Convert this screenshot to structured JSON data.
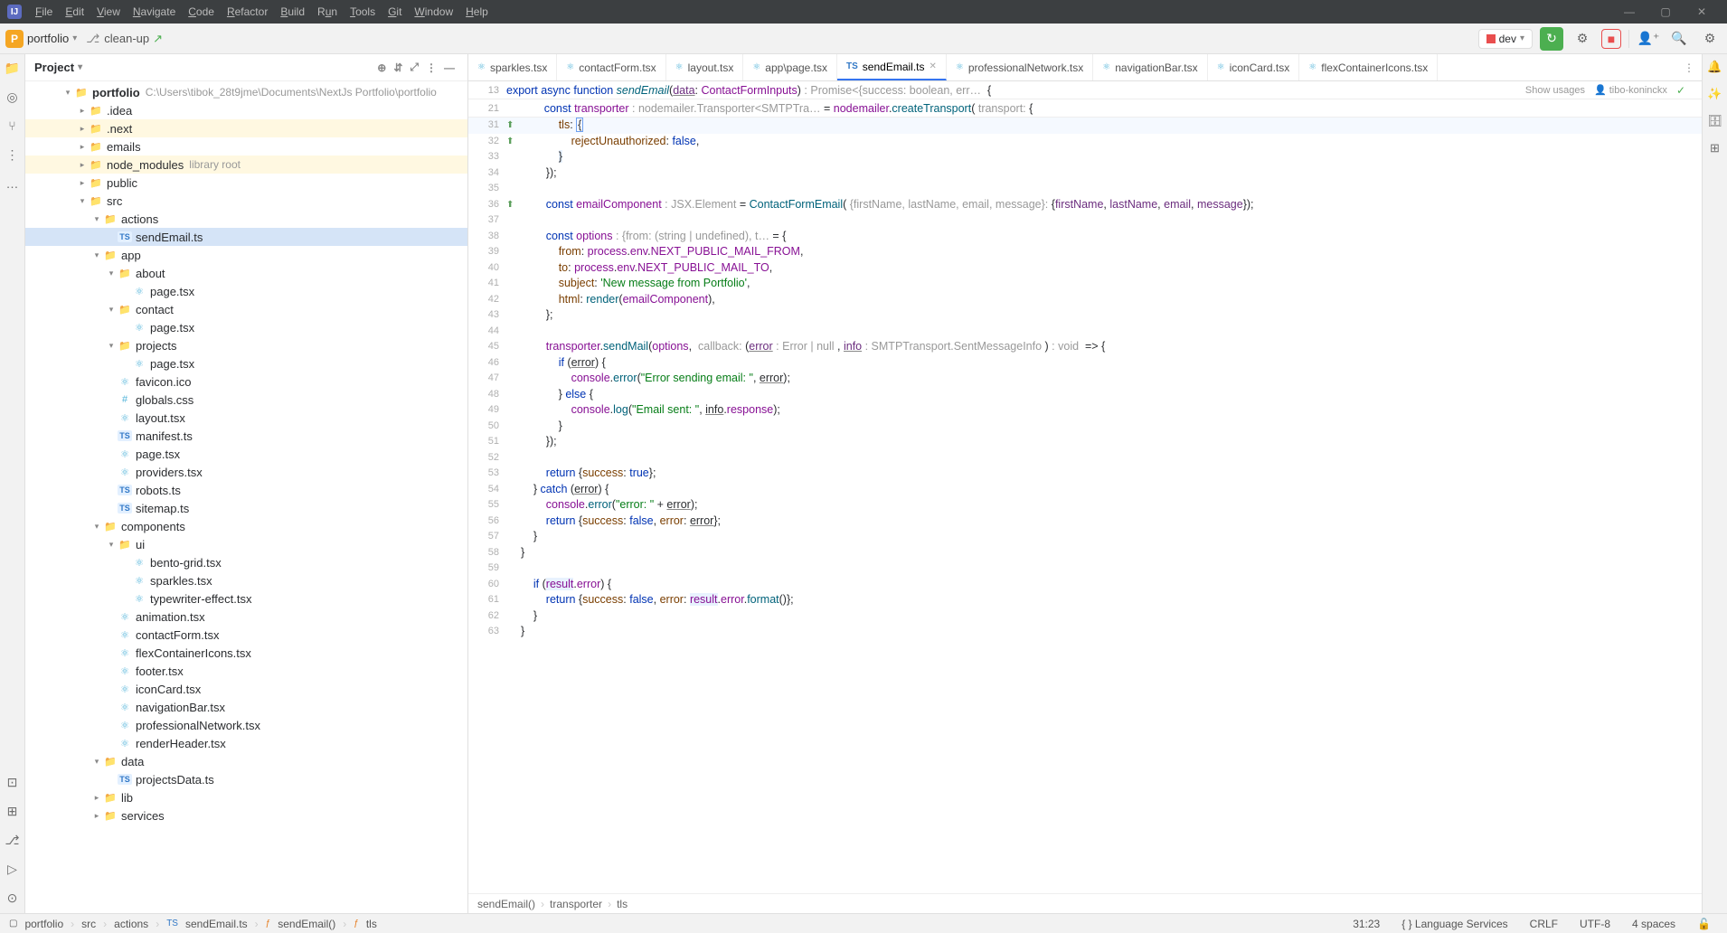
{
  "menubar": {
    "items": [
      "File",
      "Edit",
      "View",
      "Navigate",
      "Code",
      "Refactor",
      "Build",
      "Run",
      "Tools",
      "Git",
      "Window",
      "Help"
    ]
  },
  "toolbar": {
    "project": "portfolio",
    "branch": "clean-up",
    "dev": "dev"
  },
  "sidebar": {
    "title": "Project",
    "root": {
      "name": "portfolio",
      "path": "C:\\Users\\tibok_28t9jme\\Documents\\NextJs Portfolio\\portfolio"
    }
  },
  "tree": [
    {
      "d": 0,
      "a": "v",
      "i": "folder",
      "t": "portfolio",
      "bold": true,
      "extra": "C:\\Users\\tibok_28t9jme\\Documents\\NextJs Portfolio\\portfolio"
    },
    {
      "d": 1,
      "a": ">",
      "i": "folder",
      "t": ".idea",
      "hl": false
    },
    {
      "d": 1,
      "a": ">",
      "i": "folder",
      "t": ".next",
      "hl": true
    },
    {
      "d": 1,
      "a": ">",
      "i": "folder",
      "t": "emails"
    },
    {
      "d": 1,
      "a": ">",
      "i": "folder",
      "t": "node_modules",
      "hl": true,
      "extra": "library root"
    },
    {
      "d": 1,
      "a": ">",
      "i": "folder",
      "t": "public"
    },
    {
      "d": 1,
      "a": "v",
      "i": "folder",
      "t": "src"
    },
    {
      "d": 2,
      "a": "v",
      "i": "folder",
      "t": "actions"
    },
    {
      "d": 3,
      "a": "",
      "i": "ts",
      "t": "sendEmail.ts",
      "sel": true
    },
    {
      "d": 2,
      "a": "v",
      "i": "folder",
      "t": "app"
    },
    {
      "d": 3,
      "a": "v",
      "i": "folder",
      "t": "about"
    },
    {
      "d": 4,
      "a": "",
      "i": "react",
      "t": "page.tsx"
    },
    {
      "d": 3,
      "a": "v",
      "i": "folder",
      "t": "contact"
    },
    {
      "d": 4,
      "a": "",
      "i": "react",
      "t": "page.tsx"
    },
    {
      "d": 3,
      "a": "v",
      "i": "folder",
      "t": "projects"
    },
    {
      "d": 4,
      "a": "",
      "i": "react",
      "t": "page.tsx"
    },
    {
      "d": 3,
      "a": "",
      "i": "react",
      "t": "favicon.ico"
    },
    {
      "d": 3,
      "a": "",
      "i": "css",
      "t": "globals.css"
    },
    {
      "d": 3,
      "a": "",
      "i": "react",
      "t": "layout.tsx"
    },
    {
      "d": 3,
      "a": "",
      "i": "ts",
      "t": "manifest.ts"
    },
    {
      "d": 3,
      "a": "",
      "i": "react",
      "t": "page.tsx"
    },
    {
      "d": 3,
      "a": "",
      "i": "react",
      "t": "providers.tsx"
    },
    {
      "d": 3,
      "a": "",
      "i": "ts",
      "t": "robots.ts"
    },
    {
      "d": 3,
      "a": "",
      "i": "ts",
      "t": "sitemap.ts"
    },
    {
      "d": 2,
      "a": "v",
      "i": "folder",
      "t": "components"
    },
    {
      "d": 3,
      "a": "v",
      "i": "folder",
      "t": "ui"
    },
    {
      "d": 4,
      "a": "",
      "i": "react",
      "t": "bento-grid.tsx"
    },
    {
      "d": 4,
      "a": "",
      "i": "react",
      "t": "sparkles.tsx"
    },
    {
      "d": 4,
      "a": "",
      "i": "react",
      "t": "typewriter-effect.tsx"
    },
    {
      "d": 3,
      "a": "",
      "i": "react",
      "t": "animation.tsx"
    },
    {
      "d": 3,
      "a": "",
      "i": "react",
      "t": "contactForm.tsx"
    },
    {
      "d": 3,
      "a": "",
      "i": "react",
      "t": "flexContainerIcons.tsx"
    },
    {
      "d": 3,
      "a": "",
      "i": "react",
      "t": "footer.tsx"
    },
    {
      "d": 3,
      "a": "",
      "i": "react",
      "t": "iconCard.tsx"
    },
    {
      "d": 3,
      "a": "",
      "i": "react",
      "t": "navigationBar.tsx"
    },
    {
      "d": 3,
      "a": "",
      "i": "react",
      "t": "professionalNetwork.tsx"
    },
    {
      "d": 3,
      "a": "",
      "i": "react",
      "t": "renderHeader.tsx"
    },
    {
      "d": 2,
      "a": "v",
      "i": "folder",
      "t": "data"
    },
    {
      "d": 3,
      "a": "",
      "i": "ts",
      "t": "projectsData.ts"
    },
    {
      "d": 2,
      "a": ">",
      "i": "folder",
      "t": "lib"
    },
    {
      "d": 2,
      "a": ">",
      "i": "folder",
      "t": "services"
    }
  ],
  "tabs": [
    {
      "i": "react",
      "t": "sparkles.tsx"
    },
    {
      "i": "react",
      "t": "contactForm.tsx"
    },
    {
      "i": "react",
      "t": "layout.tsx"
    },
    {
      "i": "react",
      "t": "app\\page.tsx"
    },
    {
      "i": "ts",
      "t": "sendEmail.ts",
      "active": true
    },
    {
      "i": "react",
      "t": "professionalNetwork.tsx"
    },
    {
      "i": "react",
      "t": "navigationBar.tsx"
    },
    {
      "i": "react",
      "t": "iconCard.tsx"
    },
    {
      "i": "react",
      "t": "flexContainerIcons.tsx"
    }
  ],
  "sticky": {
    "ln": "13",
    "meta_usages": "Show usages",
    "meta_author": "tibo-koninckx"
  },
  "code": {
    "ln21": "21",
    "ln31": "31",
    "ln32": "32",
    "ln33": "33",
    "ln34": "34",
    "ln35": "35",
    "ln36": "36",
    "ln37": "37",
    "ln38": "38",
    "ln39": "39",
    "ln40": "40",
    "ln41": "41",
    "ln42": "42",
    "ln43": "43",
    "ln44": "44",
    "ln45": "45",
    "ln46": "46",
    "ln47": "47",
    "ln48": "48",
    "ln49": "49",
    "ln50": "50",
    "ln51": "51",
    "ln52": "52",
    "ln53": "53",
    "ln54": "54",
    "ln55": "55",
    "ln56": "56",
    "ln57": "57",
    "ln58": "58",
    "ln59": "59",
    "ln60": "60",
    "ln61": "61",
    "ln62": "62",
    "ln63": "63"
  },
  "breadcrumb_editor": {
    "a": "sendEmail()",
    "b": "transporter",
    "c": "tls"
  },
  "breadcrumb_status": {
    "a": "portfolio",
    "b": "src",
    "c": "actions",
    "d": "sendEmail.ts",
    "e": "sendEmail()",
    "f": "tls"
  },
  "statusbar": {
    "pos": "31:23",
    "lang": "Language Services",
    "crlf": "CRLF",
    "enc": "UTF-8",
    "indent": "4 spaces"
  }
}
